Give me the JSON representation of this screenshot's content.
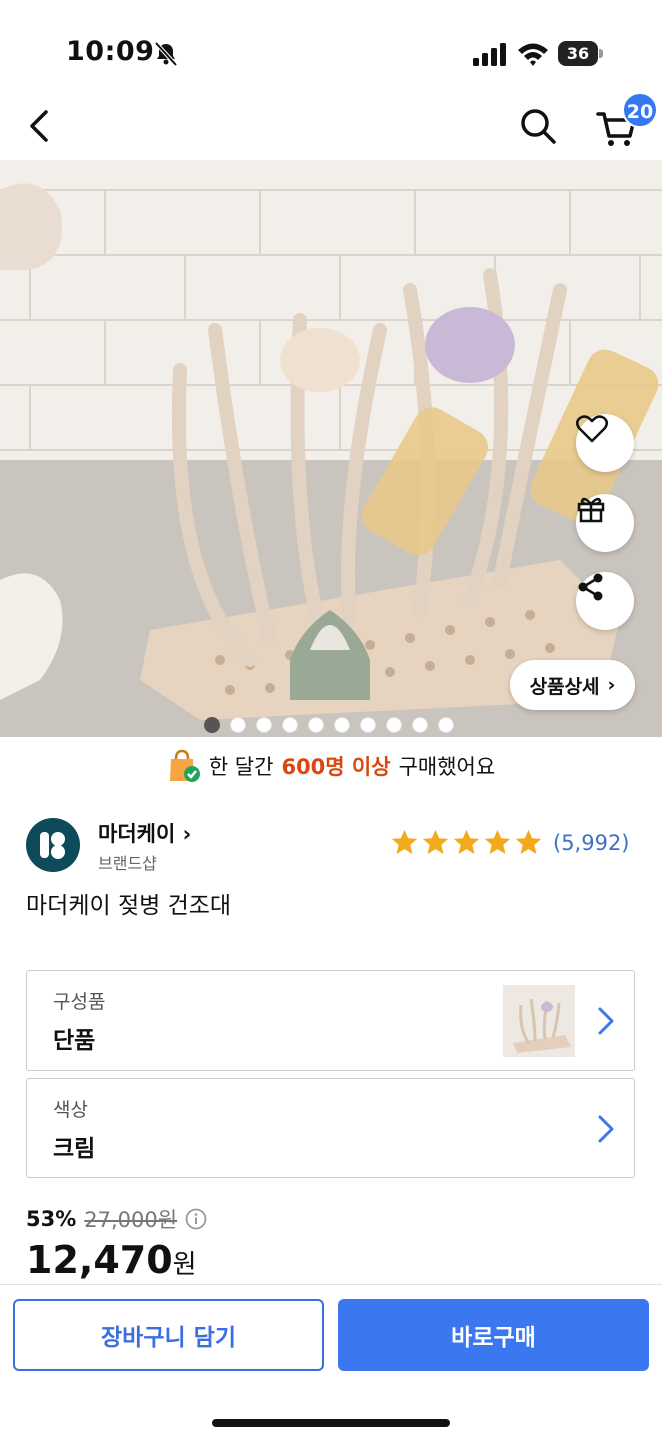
{
  "status_bar": {
    "time": "10:09",
    "battery": "36"
  },
  "nav": {
    "cart_count": "20"
  },
  "hero": {
    "total_images": 10,
    "active_index": 0,
    "detail_button": "상품상세",
    "detail_chevron": "›"
  },
  "banner": {
    "prefix": "한 달간",
    "highlight": "600명 이상",
    "suffix": "구매했어요"
  },
  "brand": {
    "name": "마더케이",
    "chevron": "›",
    "subtitle": "브랜드샵"
  },
  "rating": {
    "stars": 5,
    "count": "(5,992)"
  },
  "product": {
    "title": "마더케이 젖병 건조대"
  },
  "options": [
    {
      "label": "구성품",
      "value": "단품"
    },
    {
      "label": "색상",
      "value": "크림"
    }
  ],
  "price": {
    "discount": "53%",
    "original": "27,000원",
    "amount": "12,470",
    "unit": "원"
  },
  "actions": {
    "cart_label": "장바구니 담기",
    "buy_label": "바로구매"
  },
  "colors": {
    "accent": "#3b78f0",
    "badge": "#3478f6",
    "star": "#f2a91c",
    "highlight": "#d9480f",
    "rating_count": "#3f70c8"
  },
  "icons": [
    "bell-slash-icon",
    "signal-icon",
    "wifi-icon",
    "back-icon",
    "search-icon",
    "cart-icon",
    "heart-icon",
    "gift-icon",
    "share-icon",
    "shopping-bag-icon",
    "star-icon",
    "chevron-right-icon",
    "info-icon"
  ]
}
